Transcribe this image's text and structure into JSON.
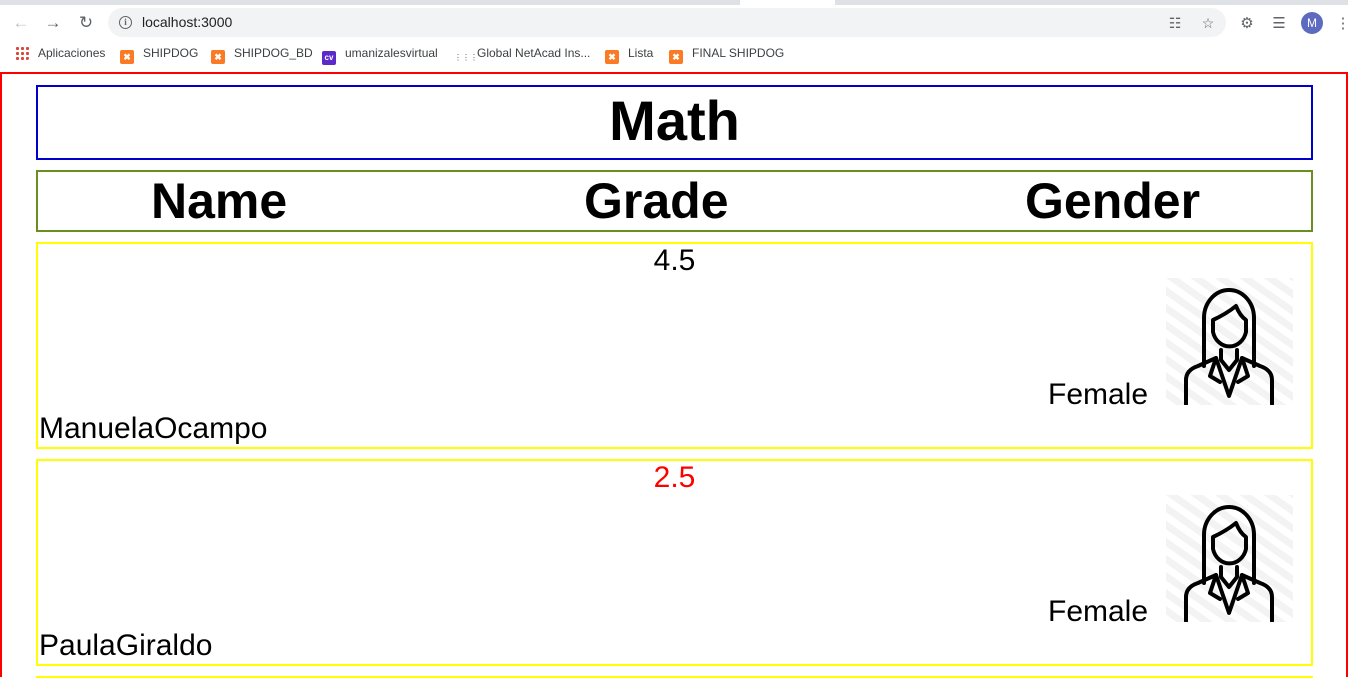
{
  "browser": {
    "url": "localhost:3000",
    "avatar_letter": "M",
    "icons": [
      "back-icon",
      "forward-icon",
      "reload-icon",
      "info-icon",
      "translate-icon",
      "star-icon",
      "extensions-icon",
      "media-icon",
      "menu-icon"
    ],
    "bookmarks": [
      {
        "label": "Aplicaciones",
        "icon": "apps-icon"
      },
      {
        "label": "SHIPDOG",
        "icon": "xampp-icon"
      },
      {
        "label": "SHIPDOG_BD",
        "icon": "xampp-icon"
      },
      {
        "label": "umanizalesvirtual",
        "icon": "cv-icon"
      },
      {
        "label": "Global NetAcad Ins...",
        "icon": "cisco-icon"
      },
      {
        "label": "Lista",
        "icon": "xampp-icon"
      },
      {
        "label": "FINAL SHIPDOG",
        "icon": "xampp-icon"
      }
    ]
  },
  "page": {
    "title": "Math",
    "headers": {
      "name": "Name",
      "grade": "Grade",
      "gender": "Gender"
    },
    "students": [
      {
        "name": "ManuelaOcampo",
        "grade": "4.5",
        "grade_color": "#000000",
        "gender": "Female",
        "avatar": "female-avatar-icon"
      },
      {
        "name": "PaulaGiraldo",
        "grade": "2.5",
        "grade_color": "#ff0000",
        "gender": "Female",
        "avatar": "female-avatar-icon"
      }
    ],
    "colors": {
      "frame": "#ff0000",
      "title_border": "#0000cc",
      "header_border": "#6b8e23",
      "row_border": "#ffff00"
    }
  }
}
